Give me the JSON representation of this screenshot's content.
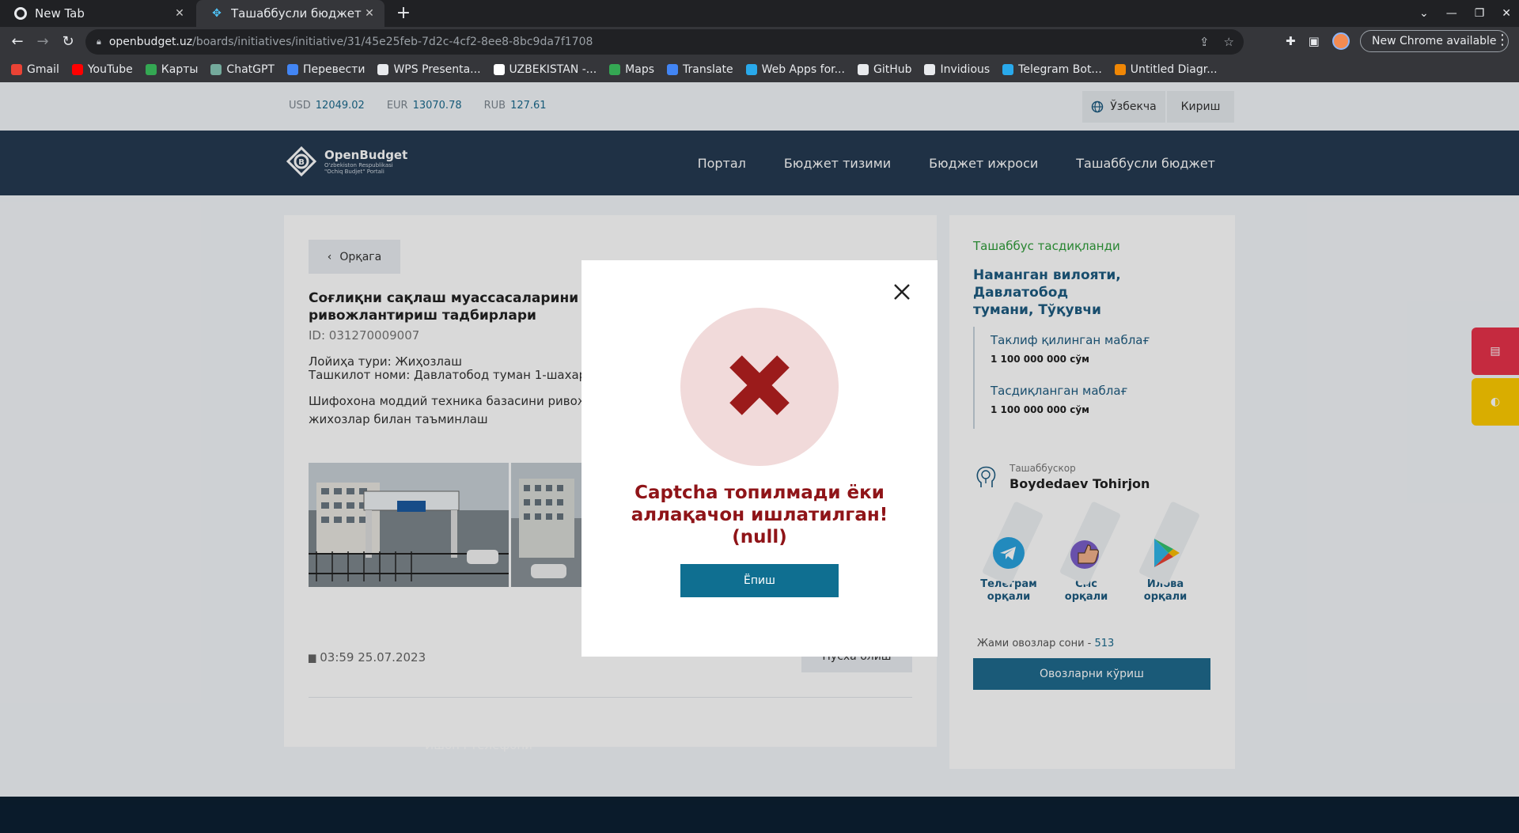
{
  "browser": {
    "tabs": [
      {
        "title": "New Tab",
        "active": false
      },
      {
        "title": "Ташаббусли бюджет",
        "active": true
      }
    ],
    "url_host": "openbudget.uz",
    "url_path": "/boards/initiatives/initiative/31/45e25feb-7d2c-4cf2-8ee8-8bc9da7f1708",
    "update_label": "New Chrome available",
    "bookmarks": [
      {
        "label": "Gmail",
        "color": "#ea4335"
      },
      {
        "label": "YouTube",
        "color": "#ff0000"
      },
      {
        "label": "Карты",
        "color": "#34a853"
      },
      {
        "label": "ChatGPT",
        "color": "#74aa9c"
      },
      {
        "label": "Перевести",
        "color": "#4285f4"
      },
      {
        "label": "WPS Presenta...",
        "color": "#e8eaed"
      },
      {
        "label": "UZBEKISTAN -...",
        "color": "#ffffff"
      },
      {
        "label": "Maps",
        "color": "#34a853"
      },
      {
        "label": "Translate",
        "color": "#4285f4"
      },
      {
        "label": "Web Apps for...",
        "color": "#29a9eb"
      },
      {
        "label": "GitHub",
        "color": "#e8eaed"
      },
      {
        "label": "Invidious",
        "color": "#e8eaed"
      },
      {
        "label": "Telegram Bot...",
        "color": "#29a9eb"
      },
      {
        "label": "Untitled Diagr...",
        "color": "#f08705"
      }
    ]
  },
  "topbar": {
    "rates": [
      {
        "code": "USD",
        "value": "12049.02"
      },
      {
        "code": "EUR",
        "value": "13070.78"
      },
      {
        "code": "RUB",
        "value": "127.61"
      }
    ],
    "language": "Ўзбекча",
    "login": "Кириш"
  },
  "nav": {
    "logo_title": "OpenBudget",
    "logo_sub1": "O'zbekiston Respublikasi",
    "logo_sub2": "\"Ochiq Budjet\" Portali",
    "items": [
      "Портал",
      "Бюджет тизими",
      "Бюджет ижроси",
      "Ташаббусли бюджет"
    ]
  },
  "project": {
    "back": "Орқага",
    "title": "Соғлиқни сақлаш муассасаларини таъм\nривожлантириш тадбирлари",
    "id": "ID: 031270009007",
    "type_line": "Лойиҳа тури: Жиҳозлаш",
    "org_line": "Ташкилот номи: Давлатобод туман 1-шахар ш",
    "description": "Шифохона моддий техника базасини ривожла\nжихозлар билан таъминлаш",
    "date": "03:59 25.07.2023",
    "copy_btn": "Нусха олиш"
  },
  "sidebar": {
    "status": "Ташаббус тасдиқланди",
    "region": "Наманган вилояти, Давлатобод\nтумани, Тўқувчи",
    "proposed_label": "Таклиф қилинган маблағ",
    "proposed_value": "1 100 000 000 сўм",
    "approved_label": "Тасдиқланган маблағ",
    "approved_value": "1 100 000 000 сўм",
    "author_role": "Ташаббускор",
    "author_name": "Boydedaev Tohirjon",
    "vote_options": [
      "Телеграм\nорқали",
      "Смс\nорқали",
      "Илова\nорқали"
    ],
    "votes_count_label": "Жами овозлар сони - ",
    "votes_count": "513",
    "votes_btn": "Овозларни кўриш"
  },
  "footer": {
    "text": "Ишонч телефони"
  },
  "modal": {
    "message": "Captcha топилмади ёки\nаллақачон ишлатилган!\n(null)",
    "ok": "Ёпиш"
  },
  "colors": {
    "accent": "#1f6a8e",
    "error": "#8f1418",
    "nav_bg": "#253a52",
    "approved": "#2f9d3a"
  }
}
